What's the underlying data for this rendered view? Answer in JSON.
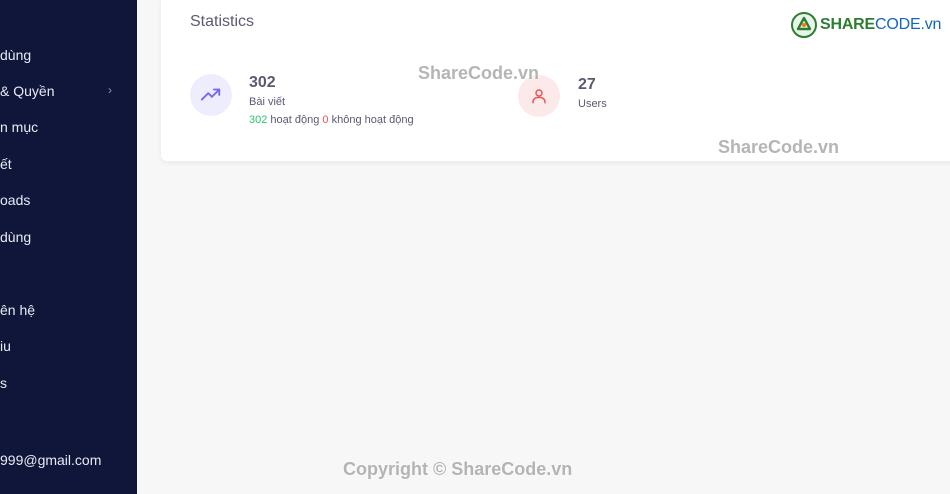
{
  "sidebar": {
    "items": [
      {
        "label": "dùng"
      },
      {
        "label": "& Quyền",
        "chevron": "›"
      },
      {
        "label": "n mục"
      },
      {
        "label": "ết"
      },
      {
        "label": "oads"
      },
      {
        "label": "dùng"
      },
      {
        "label": "ên hệ"
      },
      {
        "label": "iu"
      },
      {
        "label": "s"
      }
    ],
    "email": "999@gmail.com"
  },
  "statistics": {
    "title": "Statistics",
    "posts": {
      "icon": "trending-up-icon",
      "value": "302",
      "label": "Bài viết",
      "active_count": "302",
      "active_label": "hoạt động",
      "inactive_count": "0",
      "inactive_label": "không hoạt động"
    },
    "users": {
      "icon": "user-icon",
      "value": "27",
      "label": "Users"
    }
  },
  "logo": {
    "brand": "SHARE",
    "suffix": "CODE.vn"
  },
  "watermarks": {
    "top": "ShareCode.vn",
    "middle": "ShareCode.vn",
    "footer": "Copyright © ShareCode.vn"
  },
  "colors": {
    "sidebar_bg": "#10163a",
    "accent_purple": "#7367f0",
    "accent_red": "#ea5455",
    "accent_green": "#28c76f"
  }
}
